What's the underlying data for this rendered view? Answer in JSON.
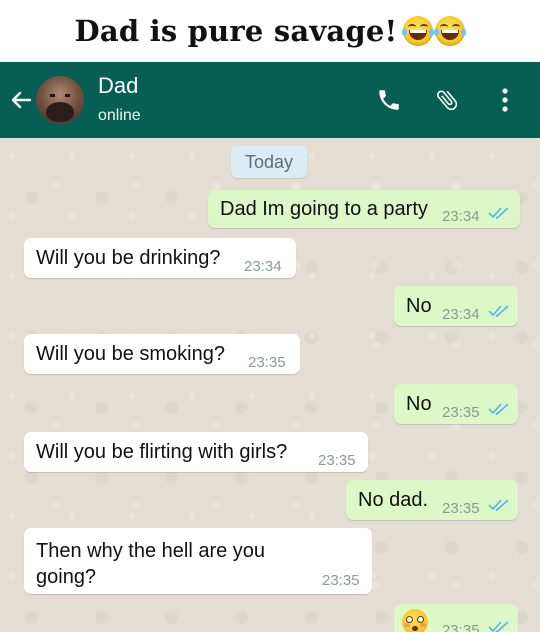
{
  "meme": {
    "title": "Dad is pure savage!"
  },
  "header": {
    "contact_name": "Dad",
    "contact_status": "online",
    "color": "#075e54",
    "icons": [
      "arrow-back-icon",
      "phone-icon",
      "paperclip-icon",
      "more-vert-icon"
    ]
  },
  "chat": {
    "date_label": "Today",
    "outgoing_color": "#dcf8c6",
    "incoming_color": "#ffffff",
    "messages": [
      {
        "direction": "outgoing",
        "text": "Dad Im going to a party",
        "time": "23:34",
        "status": "read"
      },
      {
        "direction": "incoming",
        "text": "Will you be drinking?",
        "time": "23:34"
      },
      {
        "direction": "outgoing",
        "text": "No",
        "time": "23:34",
        "status": "read"
      },
      {
        "direction": "incoming",
        "text": "Will you be smoking?",
        "time": "23:35"
      },
      {
        "direction": "outgoing",
        "text": "No",
        "time": "23:35",
        "status": "read"
      },
      {
        "direction": "incoming",
        "text": "Will you be flirting with girls?",
        "time": "23:35"
      },
      {
        "direction": "outgoing",
        "text": "No dad.",
        "time": "23:35",
        "status": "read"
      },
      {
        "direction": "incoming",
        "text": "Then why the hell are you going?",
        "time": "23:35"
      },
      {
        "direction": "outgoing",
        "text": "",
        "emoji": "flushed-face",
        "time": "23:35",
        "status": "read"
      }
    ]
  }
}
